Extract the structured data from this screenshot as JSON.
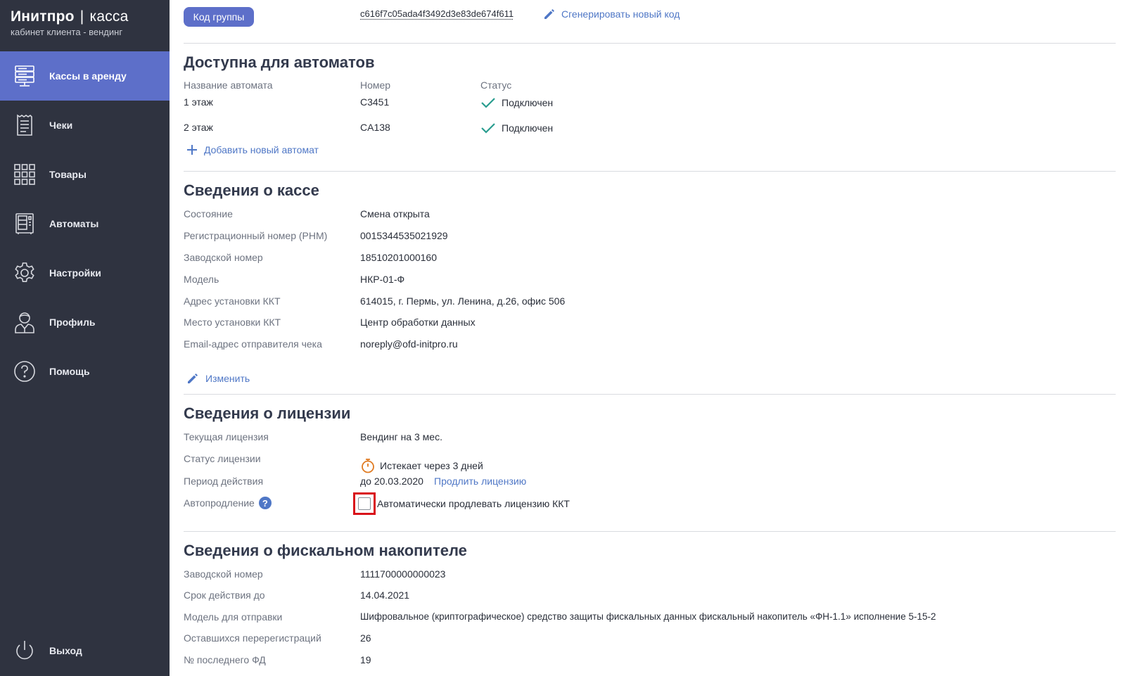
{
  "brand": {
    "title": "Инитпро",
    "separator": "|",
    "title_suffix": "касса",
    "subtitle": "кабинет клиента - вендинг"
  },
  "nav": {
    "items": [
      {
        "label": "Кассы в аренду",
        "icon": "server-icon",
        "active": true
      },
      {
        "label": "Чеки",
        "icon": "receipt-icon",
        "active": false
      },
      {
        "label": "Товары",
        "icon": "grid-icon",
        "active": false
      },
      {
        "label": "Автоматы",
        "icon": "vending-machine-icon",
        "active": false
      },
      {
        "label": "Настройки",
        "icon": "gear-icon",
        "active": false
      },
      {
        "label": "Профиль",
        "icon": "user-icon",
        "active": false
      },
      {
        "label": "Помощь",
        "icon": "help-circle-icon",
        "active": false
      }
    ],
    "logout": {
      "label": "Выход",
      "icon": "power-icon"
    }
  },
  "group": {
    "button_label": "Код группы",
    "code": "c616f7c05ada4f3492d3e83de674f611",
    "generate_label": "Сгенерировать новый код"
  },
  "machines": {
    "title": "Доступна для автоматов",
    "columns": [
      "Название автомата",
      "Номер",
      "Статус"
    ],
    "rows": [
      {
        "name": "1 этаж",
        "number": "C3451",
        "status": "Подключен"
      },
      {
        "name": "2 этаж",
        "number": "CA138",
        "status": "Подключен"
      }
    ],
    "add_label": "Добавить новый автомат"
  },
  "register": {
    "title": "Сведения о кассе",
    "fields": [
      {
        "label": "Состояние",
        "value": "Смена открыта"
      },
      {
        "label": "Регистрационный номер (РНМ)",
        "value": "0015344535021929"
      },
      {
        "label": "Заводской номер",
        "value": "18510201000160"
      },
      {
        "label": "Модель",
        "value": "НКР-01-Ф"
      },
      {
        "label": "Адрес установки ККТ",
        "value": "614015, г. Пермь, ул. Ленина, д.26, офис 506"
      },
      {
        "label": "Место установки ККТ",
        "value": "Центр обработки данных"
      },
      {
        "label": "Email-адрес отправителя чека",
        "value": "noreply@ofd-initpro.ru"
      }
    ],
    "edit_label": "Изменить"
  },
  "license": {
    "title": "Сведения о лицензии",
    "current_label": "Текущая лицензия",
    "current_value": "Вендинг на 3 мес.",
    "status_label": "Статус лицензии",
    "status_value": "Истекает через 3 дней",
    "period_label": "Период действия",
    "period_value": "до 20.03.2020",
    "renew_label": "Продлить лицензию",
    "auto_label": "Автопродление",
    "auto_help": "?",
    "auto_checkbox_label": "Автоматически продлевать лицензию ККТ",
    "auto_checked": false
  },
  "fn": {
    "title": "Сведения о фискальном накопителе",
    "fields": [
      {
        "label": "Заводской номер",
        "value": "1111700000000023"
      },
      {
        "label": "Срок действия до",
        "value": "14.04.2021"
      },
      {
        "label": "Модель для отправки",
        "value": "Шифровальное (криптографическое) средство защиты фискальных данных фискальный накопитель «ФН-1.1» исполнение 5-15-2"
      },
      {
        "label": "Оставшихся перерегистраций",
        "value": "26"
      },
      {
        "label": "№ последнего ФД",
        "value": "19"
      }
    ]
  },
  "colors": {
    "sidebar": "#2f3340",
    "accent": "#5d6fc9",
    "link": "#4f77c6",
    "ok": "#2a9d8f",
    "warn": "#e07b22",
    "highlight": "#d9121a"
  }
}
